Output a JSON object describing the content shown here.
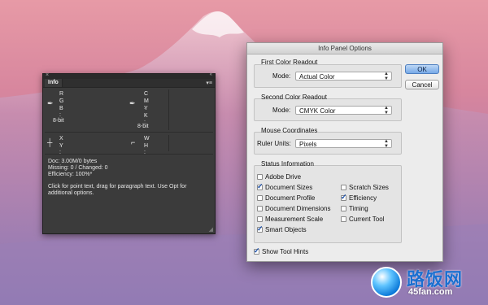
{
  "info_panel": {
    "tab_label": "Info",
    "menu_icon": "panel-menu-icon",
    "first_readout": {
      "r": "R :",
      "g": "G :",
      "b": "B :",
      "bit": "8-bit"
    },
    "second_readout": {
      "c": "C :",
      "m": "M :",
      "y": "Y :",
      "k": "K :",
      "bit": "8-bit"
    },
    "coords": {
      "x": "X :",
      "y": "Y :"
    },
    "size": {
      "w": "W :",
      "h": "H :"
    },
    "status": {
      "doc": "Doc: 3.00M/0 bytes",
      "missing": "Missing: 0 / Changed: 0",
      "efficiency": "Efficiency: 100%*"
    },
    "hint_lines": [
      "Click for point text, drag for paragraph text.  Use Opt for",
      "additional options."
    ]
  },
  "dialog": {
    "title": "Info Panel Options",
    "first_color": {
      "heading": "First Color Readout",
      "mode_label": "Mode:",
      "mode_value": "Actual Color"
    },
    "second_color": {
      "heading": "Second Color Readout",
      "mode_label": "Mode:",
      "mode_value": "CMYK Color"
    },
    "mouse": {
      "heading": "Mouse Coordinates",
      "units_label": "Ruler Units:",
      "units_value": "Pixels"
    },
    "status": {
      "heading": "Status Information",
      "left": [
        {
          "label": "Adobe Drive",
          "checked": false
        },
        {
          "label": "Document Sizes",
          "checked": true
        },
        {
          "label": "Document Profile",
          "checked": false
        },
        {
          "label": "Document Dimensions",
          "checked": false
        },
        {
          "label": "Measurement Scale",
          "checked": false
        },
        {
          "label": "Smart Objects",
          "checked": true
        }
      ],
      "right": [
        {
          "label": "Scratch Sizes",
          "checked": false
        },
        {
          "label": "Efficiency",
          "checked": true
        },
        {
          "label": "Timing",
          "checked": false
        },
        {
          "label": "Current Tool",
          "checked": false
        }
      ]
    },
    "show_tool_hints": {
      "label": "Show Tool Hints",
      "checked": true
    },
    "ok_label": "OK",
    "cancel_label": "Cancel"
  },
  "watermark": {
    "title": "路饭网",
    "domain": "45fan.com"
  }
}
